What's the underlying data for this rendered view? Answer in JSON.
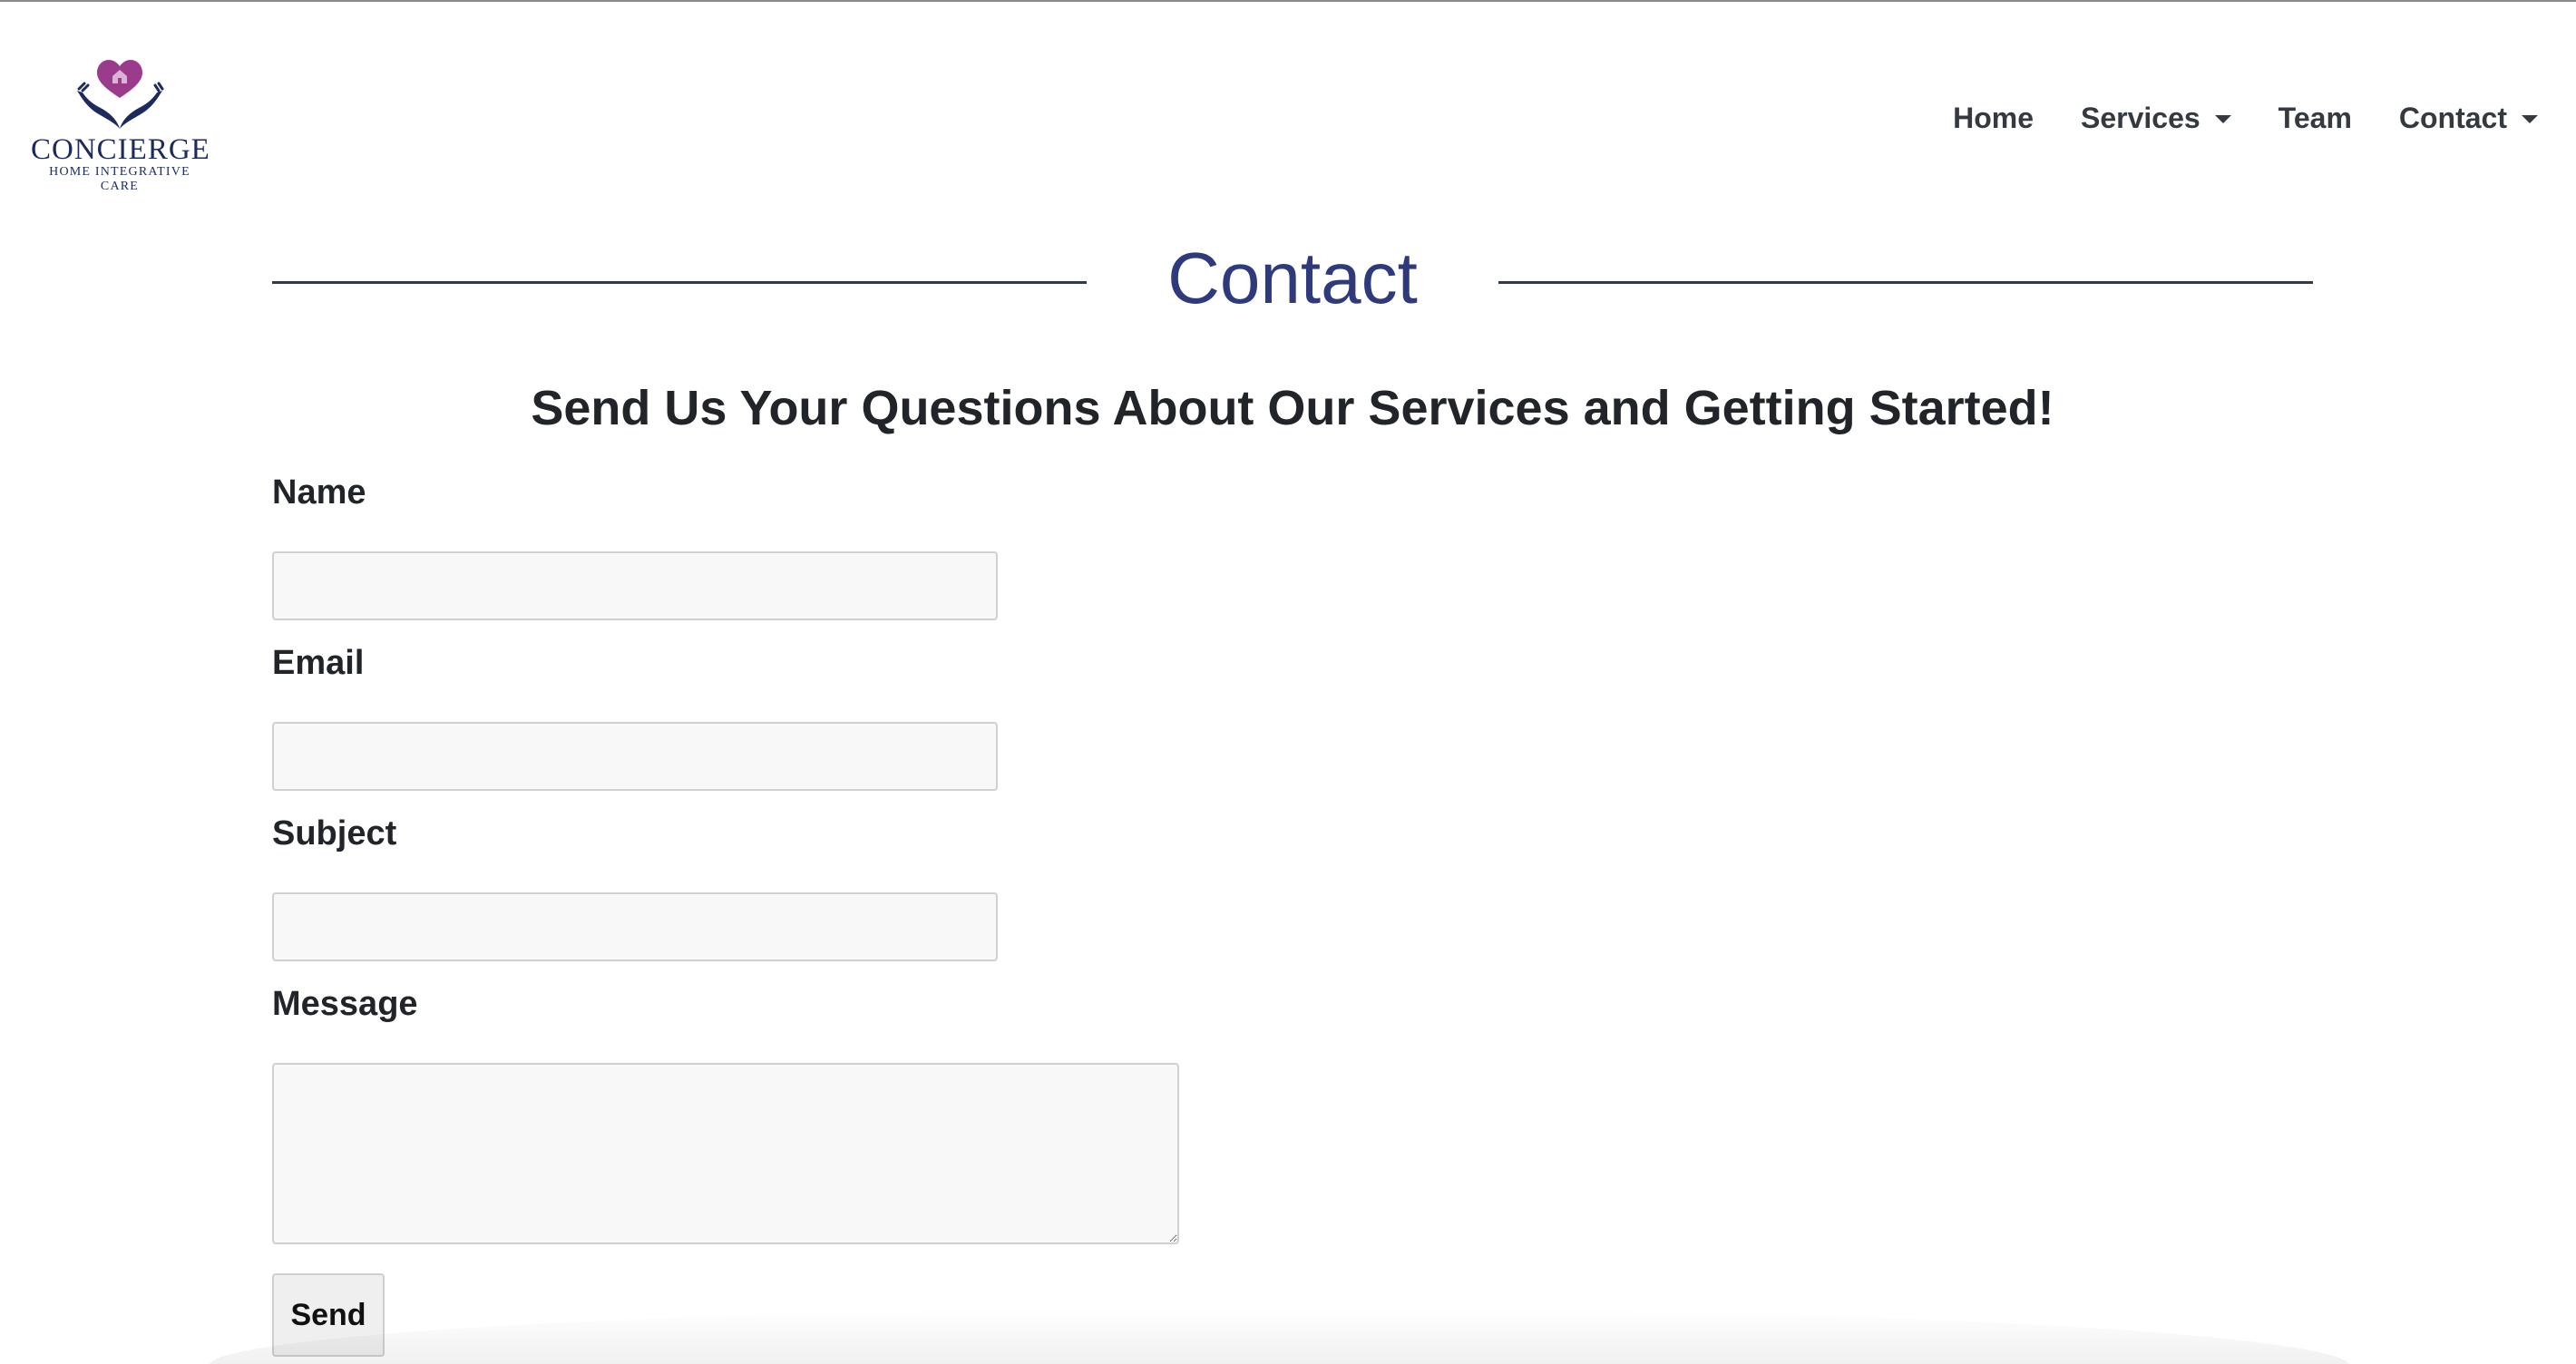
{
  "brand": {
    "name": "CONCIERGE",
    "tagline": "HOME INTEGRATIVE CARE",
    "colors": {
      "heart": "#9b3b8c",
      "hands": "#1d2b5c"
    }
  },
  "nav": {
    "items": [
      {
        "label": "Home",
        "dropdown": false
      },
      {
        "label": "Services",
        "dropdown": true
      },
      {
        "label": "Team",
        "dropdown": false
      },
      {
        "label": "Contact",
        "dropdown": true
      }
    ]
  },
  "page": {
    "title": "Contact",
    "subtitle": "Send Us Your Questions About Our Services and Getting Started!",
    "title_color": "#2e3a7c"
  },
  "form": {
    "name_label": "Name",
    "name_value": "",
    "email_label": "Email",
    "email_value": "",
    "subject_label": "Subject",
    "subject_value": "",
    "message_label": "Message",
    "message_value": "",
    "send_label": "Send"
  }
}
